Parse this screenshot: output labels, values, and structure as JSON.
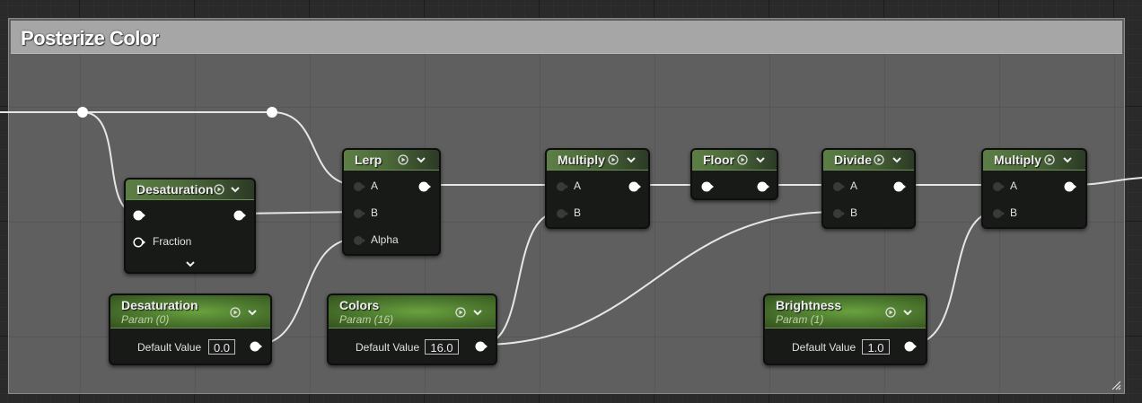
{
  "comment": {
    "title": "Posterize Color"
  },
  "nodes": {
    "desaturation_fn": {
      "title": "Desaturation",
      "fraction_label": "Fraction"
    },
    "lerp": {
      "title": "Lerp",
      "pin_a": "A",
      "pin_b": "B",
      "pin_alpha": "Alpha"
    },
    "multiply1": {
      "title": "Multiply",
      "pin_a": "A",
      "pin_b": "B"
    },
    "floor": {
      "title": "Floor"
    },
    "divide": {
      "title": "Divide",
      "pin_a": "A",
      "pin_b": "B"
    },
    "multiply2": {
      "title": "Multiply",
      "pin_a": "A",
      "pin_b": "B"
    },
    "param_desaturation": {
      "title": "Desaturation",
      "subtitle": "Param (0)",
      "default_label": "Default Value",
      "default_value": "0.0"
    },
    "param_colors": {
      "title": "Colors",
      "subtitle": "Param (16)",
      "default_label": "Default Value",
      "default_value": "16.0"
    },
    "param_brightness": {
      "title": "Brightness",
      "subtitle": "Param (1)",
      "default_label": "Default Value",
      "default_value": "1.0"
    }
  },
  "colors": {
    "node_header_green": "#5d7f46",
    "param_header_green": "#6aa23e",
    "wire": "#e6e6e6",
    "comment_title_bar": "#a6a6a6"
  },
  "icons": [
    "expand-arrow-icon",
    "preview-toggle-icon",
    "collapse-chevron-icon",
    "resize-grip-icon"
  ]
}
